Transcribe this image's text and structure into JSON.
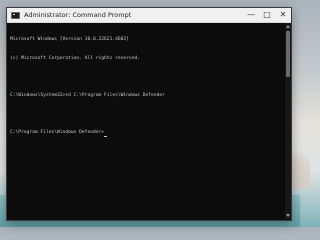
{
  "window": {
    "title": "Administrator: Command Prompt",
    "buttons": {
      "minimize": "—",
      "maximize": "□",
      "close": "✕"
    }
  },
  "console": {
    "lines": [
      "Microsoft Windows [Version 10.0.22621.4602]",
      "(c) Microsoft Corporation. All rights reserved.",
      "",
      "C:\\Windows\\System32>cd C:\\Program Files\\Windows Defender",
      "",
      "C:\\Program Files\\Windows Defender>"
    ]
  },
  "colors": {
    "console_bg": "#0c0c0c",
    "console_text": "#cccccc",
    "titlebar_bg": "#f0f0f0"
  }
}
